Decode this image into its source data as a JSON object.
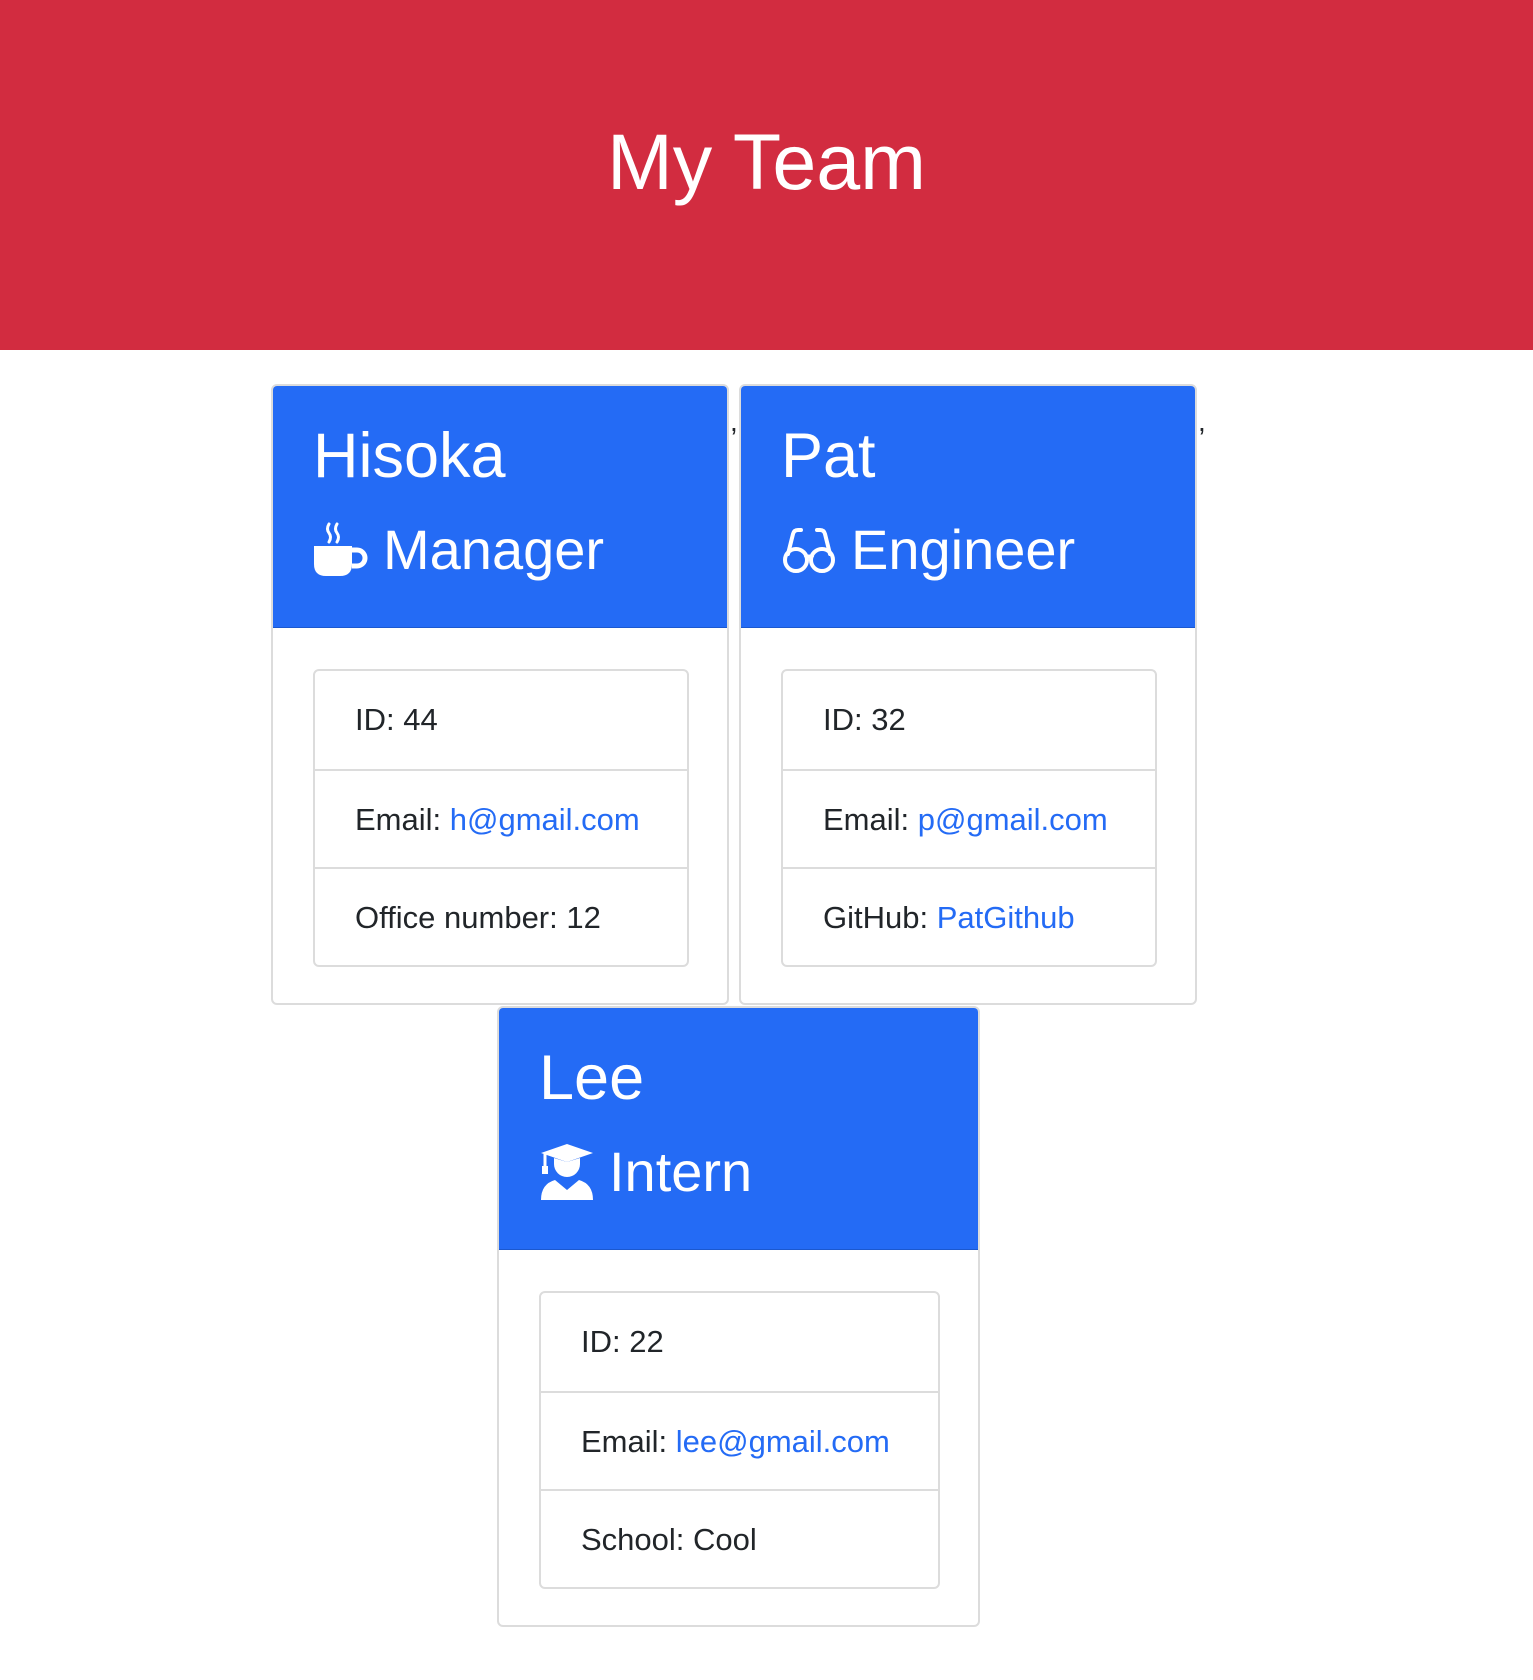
{
  "header": {
    "title": "My Team"
  },
  "separator": ",",
  "members": [
    {
      "name": "Hisoka",
      "role": "Manager",
      "icon": "mug-hot-icon",
      "id_label": "ID: ",
      "id": "44",
      "email_label": "Email: ",
      "email": "h@gmail.com",
      "extra_label": "Office number: ",
      "extra_value": "12"
    },
    {
      "name": "Pat",
      "role": "Engineer",
      "icon": "glasses-icon",
      "id_label": "ID: ",
      "id": "32",
      "email_label": "Email: ",
      "email": "p@gmail.com",
      "extra_label": "GitHub: ",
      "extra_value": "PatGithub"
    },
    {
      "name": "Lee",
      "role": "Intern",
      "icon": "user-graduate-icon",
      "id_label": "ID: ",
      "id": "22",
      "email_label": "Email: ",
      "email": "lee@gmail.com",
      "extra_label": "School: ",
      "extra_value": "Cool"
    }
  ],
  "colors": {
    "header_bg": "#d22c40",
    "card_header_bg": "#246bf5",
    "link": "#246bf5"
  }
}
